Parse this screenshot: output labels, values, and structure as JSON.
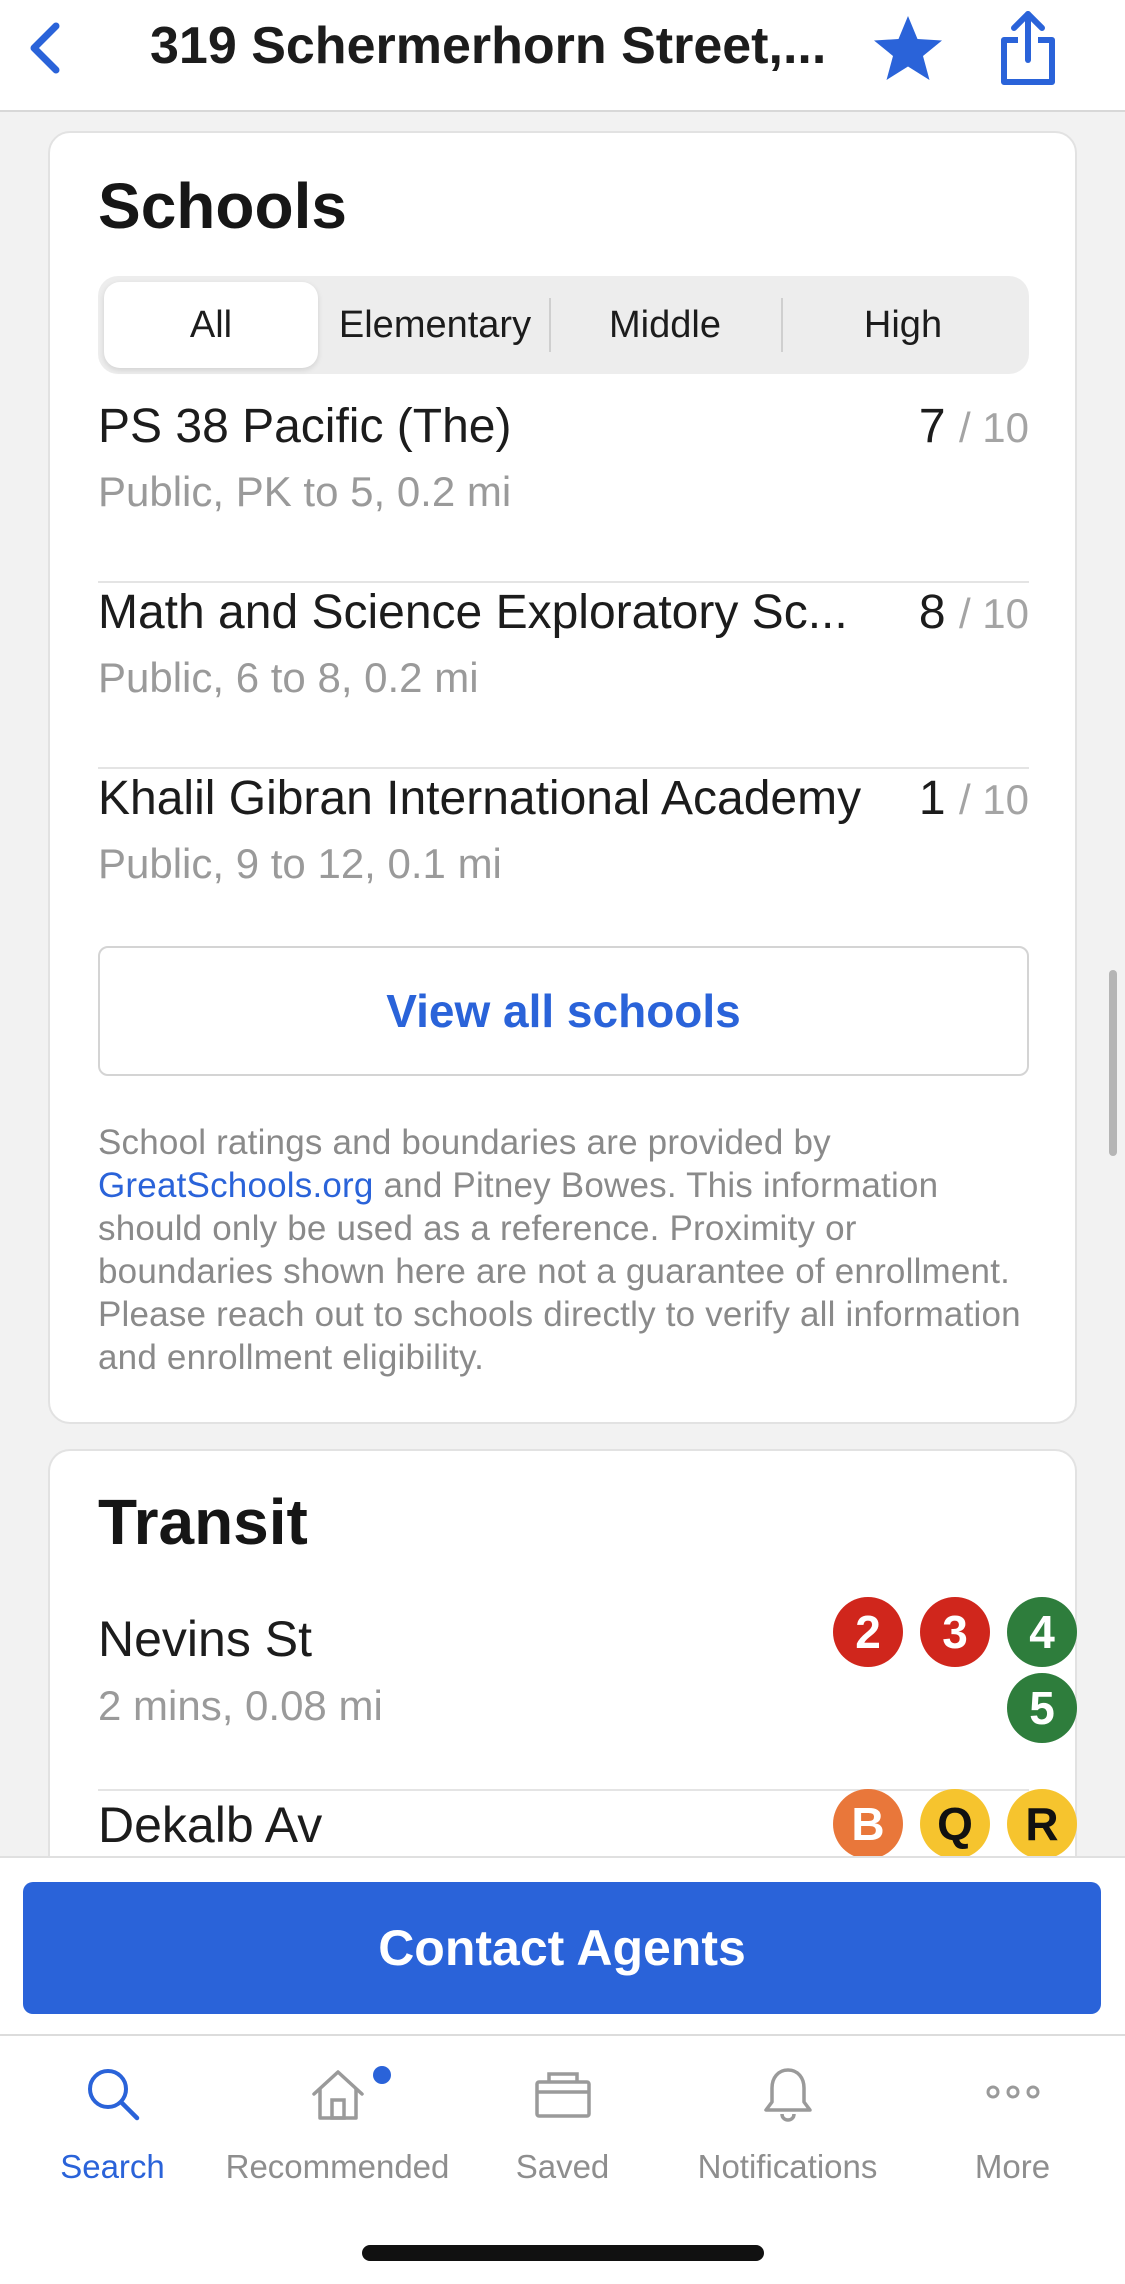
{
  "header": {
    "title": "319 Schermerhorn Street,...",
    "accent": "#2a63d9"
  },
  "schools": {
    "title": "Schools",
    "tabs": [
      "All",
      "Elementary",
      "Middle",
      "High"
    ],
    "selected_tab": "All",
    "items": [
      {
        "name": "PS 38 Pacific (The)",
        "rating": "7",
        "rating_max": "/ 10",
        "meta": "Public, PK to 5, 0.2 mi"
      },
      {
        "name": "Math and Science Exploratory Sc...",
        "rating": "8",
        "rating_max": "/ 10",
        "meta": "Public, 6 to 8, 0.2 mi"
      },
      {
        "name": "Khalil Gibran International Academy",
        "rating": "1",
        "rating_max": "/ 10",
        "meta": "Public, 9 to 12, 0.1 mi"
      }
    ],
    "view_all_label": "View all schools",
    "disclaimer_before": "School ratings and boundaries are provided by ",
    "disclaimer_link": "GreatSchools.org",
    "disclaimer_after": " and Pitney Bowes. This information should only be used as a reference. Proximity or boundaries shown here are not a guarantee of enrollment. Please reach out to schools directly to verify all information and enrollment eligibility."
  },
  "transit": {
    "title": "Transit",
    "stations": [
      {
        "name": "Nevins St",
        "meta": "2 mins, 0.08 mi",
        "lines": [
          {
            "label": "2",
            "color": "#d0261c",
            "text_color": "#ffffff"
          },
          {
            "label": "3",
            "color": "#d0261c",
            "text_color": "#ffffff"
          },
          {
            "label": "4",
            "color": "#2e7d3c",
            "text_color": "#ffffff"
          },
          {
            "label": "5",
            "color": "#2e7d3c",
            "text_color": "#ffffff"
          }
        ]
      },
      {
        "name": "Dekalb Av",
        "meta": "",
        "lines": [
          {
            "label": "B",
            "color": "#e9773a",
            "text_color": "#ffffff"
          },
          {
            "label": "Q",
            "color": "#f6c42e",
            "text_color": "#111111"
          },
          {
            "label": "R",
            "color": "#f6c42e",
            "text_color": "#111111"
          }
        ]
      }
    ]
  },
  "contact_button_label": "Contact Agents",
  "tabbar": {
    "items": [
      {
        "label": "Search",
        "icon": "search-icon",
        "active": true
      },
      {
        "label": "Recommended",
        "icon": "home-icon",
        "badge": true
      },
      {
        "label": "Saved",
        "icon": "saved-box-icon"
      },
      {
        "label": "Notifications",
        "icon": "bell-icon"
      },
      {
        "label": "More",
        "icon": "more-dots-icon"
      }
    ]
  }
}
